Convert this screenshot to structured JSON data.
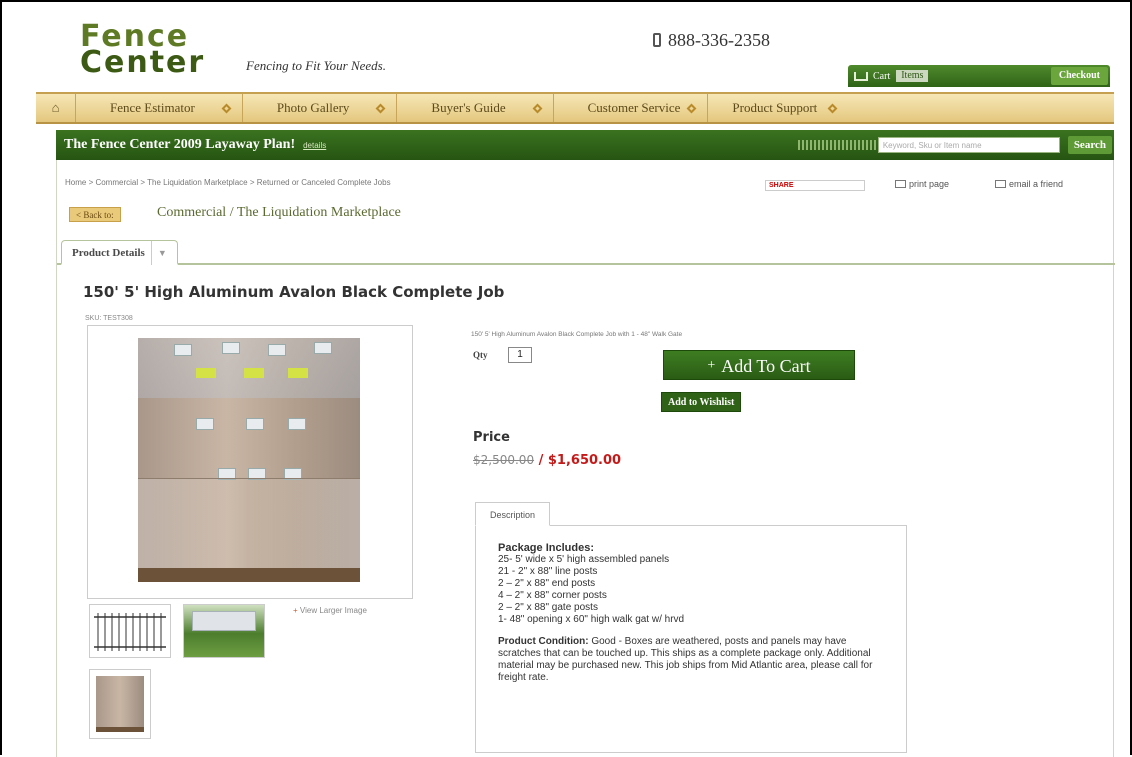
{
  "header": {
    "logo_line1": "Fence",
    "logo_line2": "Center",
    "tagline": "Fencing to Fit Your Needs.",
    "phone": "888-336-2358",
    "cart_label": "Cart",
    "cart_count": "Items",
    "checkout_label": "Checkout"
  },
  "nav": {
    "home_icon": "home-icon",
    "items": [
      {
        "label": "Fence Estimator"
      },
      {
        "label": "Photo Gallery"
      },
      {
        "label": "Buyer's Guide"
      },
      {
        "label": "Customer Service"
      },
      {
        "label": "Product Support"
      }
    ]
  },
  "promo": {
    "title": "The Fence Center 2009 Layaway Plan!",
    "link": "details",
    "search_placeholder": "Keyword, Sku or Item name",
    "search_button": "Search"
  },
  "breadcrumb": "Home > Commercial > The Liquidation Marketplace > Returned or Canceled Complete Jobs",
  "tools": {
    "share": "SHARE",
    "print": "print page",
    "email": "email a friend"
  },
  "back_button": "< Back to:",
  "category": "Commercial / The Liquidation Marketplace",
  "tab_label": "Product Details",
  "product": {
    "title": "150' 5' High Aluminum Avalon Black Complete Job",
    "sku": "SKU: TEST308",
    "short_desc": "150' 5' High Aluminum Avalon Black Complete Job with 1 - 48\" Walk Gate",
    "qty_label": "Qty",
    "qty_value": "1",
    "add_to_cart": "Add To Cart",
    "add_to_wishlist": "Add to Wishlist",
    "price_label": "Price",
    "old_price": "$2,500.00",
    "separator": " / ",
    "new_price": "$1,650.00",
    "view_larger": "View Larger Image"
  },
  "description": {
    "tab": "Description",
    "package_heading": "Package Includes:",
    "items": [
      "25- 5' wide x 5' high assembled panels",
      "21 - 2\" x 88\" line posts",
      "2 – 2\" x 88\" end posts",
      "4 – 2\" x 88\" corner posts",
      "2 – 2\" x 88\" gate posts",
      "1- 48\" opening x 60\" high walk gat w/ hrvd"
    ],
    "condition_label": "Product Condition:",
    "condition_text": " Good - Boxes are weathered, posts and panels may have scratches that can be touched up. This ships as a complete package only. Additional material may be purchased new. This job ships from Mid Atlantic area, please call for freight rate."
  },
  "colors": {
    "brand_green": "#2f6317",
    "nav_gold": "#e4c77e",
    "sale_red": "#c41a1a"
  }
}
